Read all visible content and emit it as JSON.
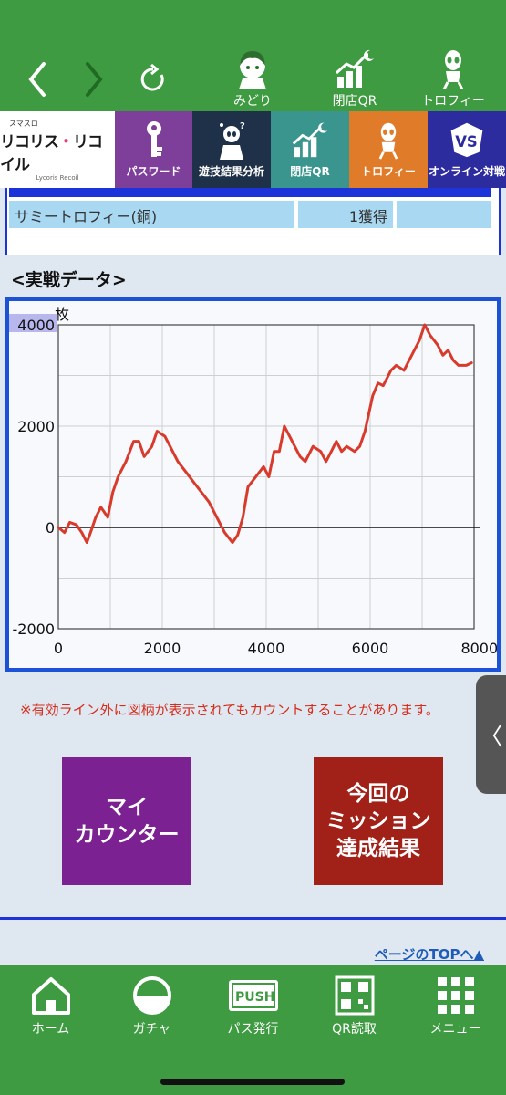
{
  "top_nav": {
    "links": [
      {
        "label": "みどり",
        "icon": "character-icon"
      },
      {
        "label": "閉店QR",
        "icon": "chart-moon-icon"
      },
      {
        "label": "トロフィー",
        "icon": "alien-trophy-icon"
      }
    ]
  },
  "logo": {
    "small": "スマスロ",
    "main_a": "リコリス",
    "main_b": "・",
    "main_c": "リコイル",
    "sub": "Lycoris Recoil"
  },
  "tabs": [
    {
      "label": "パスワード",
      "icon": "key-icon",
      "color": "#7e3f9a"
    },
    {
      "label": "遊技結果分析",
      "icon": "analysis-icon",
      "color": "#1e3148"
    },
    {
      "label": "閉店QR",
      "icon": "chart-moon-icon",
      "color": "#3a958e"
    },
    {
      "label": "トロフィー",
      "icon": "alien-trophy-icon",
      "color": "#e07b2a"
    },
    {
      "label": "オンライン対戦",
      "icon": "vs-icon",
      "color": "#2d2c9e"
    }
  ],
  "trophy": {
    "name": "サミートロフィー(銅)",
    "count": "1獲得"
  },
  "section_title": "<実戦データ>",
  "chart_data": {
    "type": "line",
    "ylabel": "枚",
    "x_tick_labels": [
      "0",
      "2000",
      "4000",
      "6000",
      "8000G"
    ],
    "y_tick_labels": [
      "4000",
      "2000",
      "0",
      "-2000"
    ],
    "xlim": [
      0,
      8000
    ],
    "ylim": [
      -2000,
      4000
    ],
    "grid": true,
    "line_color": "#d83a2c",
    "series": [
      {
        "x": [
          0,
          120,
          220,
          350,
          450,
          550,
          620,
          720,
          820,
          950,
          1050,
          1150,
          1300,
          1450,
          1550,
          1650,
          1800,
          1900,
          2050,
          2150,
          2300,
          2450,
          2600,
          2750,
          2900,
          3050,
          3200,
          3350,
          3450,
          3550,
          3650,
          3800,
          3950,
          4050,
          4150,
          4250,
          4350,
          4450,
          4550,
          4650,
          4750,
          4900,
          5050,
          5150,
          5250,
          5350,
          5450,
          5550,
          5700,
          5800,
          5900,
          6050,
          6150,
          6250,
          6400,
          6500,
          6650,
          6800,
          6950,
          7050,
          7150,
          7300,
          7400,
          7500,
          7600,
          7700,
          7850,
          7950
        ],
        "y": [
          0,
          -100,
          100,
          50,
          -100,
          -300,
          -100,
          200,
          400,
          200,
          700,
          1000,
          1300,
          1700,
          1700,
          1400,
          1600,
          1900,
          1800,
          1600,
          1300,
          1100,
          900,
          700,
          500,
          200,
          -100,
          -300,
          -150,
          200,
          800,
          1000,
          1200,
          1000,
          1500,
          1500,
          2000,
          1800,
          1600,
          1400,
          1300,
          1600,
          1500,
          1300,
          1500,
          1700,
          1500,
          1600,
          1500,
          1600,
          1900,
          2600,
          2850,
          2800,
          3100,
          3200,
          3100,
          3400,
          3700,
          4000,
          3800,
          3600,
          3400,
          3500,
          3300,
          3200,
          3200,
          3250
        ]
      }
    ]
  },
  "note": "※有効ライン外に図柄が表示されてもカウントすることがあります。",
  "buttons": {
    "mycounter_line1": "マイ",
    "mycounter_line2": "カウンター",
    "mission_line1": "今回の",
    "mission_line2": "ミッション",
    "mission_line3": "達成結果"
  },
  "page_top": "ページのTOPへ▲",
  "side_tab": "〈",
  "bottom_nav": [
    {
      "label": "ホーム",
      "icon": "home-icon"
    },
    {
      "label": "ガチャ",
      "icon": "gacha-icon"
    },
    {
      "label": "パス発行",
      "icon": "push-icon"
    },
    {
      "label": "QR読取",
      "icon": "qr-icon"
    },
    {
      "label": "メニュー",
      "icon": "grid-menu-icon"
    }
  ],
  "push_label": "PUSH"
}
